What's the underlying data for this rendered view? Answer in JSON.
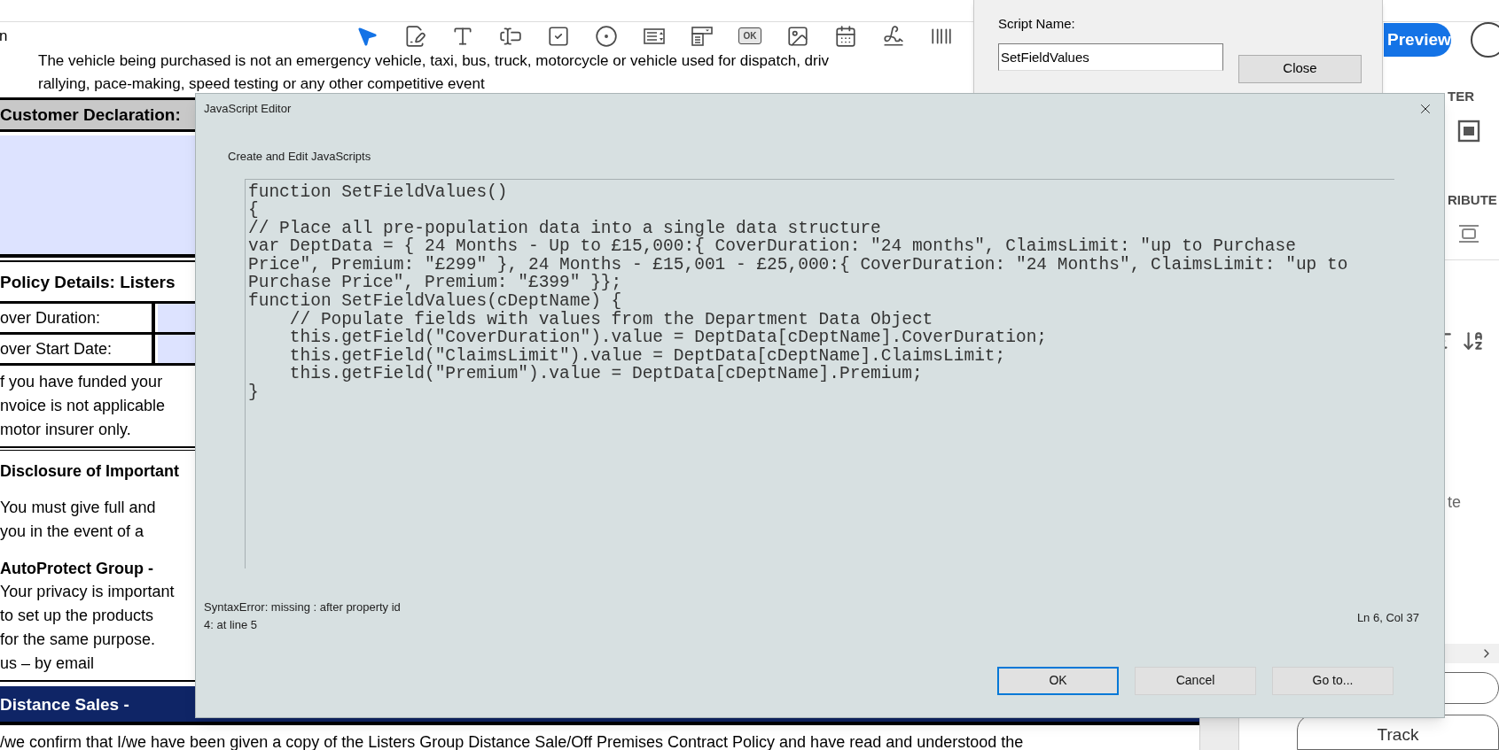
{
  "toolbar": {
    "cropped_label": "n",
    "tools": [
      {
        "kind": "select",
        "selected": true
      },
      {
        "kind": "edit-form",
        "selected": false
      },
      {
        "kind": "text",
        "selected": false
      },
      {
        "kind": "text-field",
        "selected": false
      },
      {
        "kind": "checkbox",
        "selected": false
      },
      {
        "kind": "radio",
        "selected": false
      },
      {
        "kind": "list-box",
        "selected": false
      },
      {
        "kind": "dropdown",
        "selected": false
      },
      {
        "kind": "button",
        "selected": false,
        "label": "OK"
      },
      {
        "kind": "image",
        "selected": false
      },
      {
        "kind": "date",
        "selected": false
      },
      {
        "kind": "signature",
        "selected": false
      },
      {
        "kind": "barcode",
        "selected": false
      }
    ]
  },
  "document": {
    "intro_lines": [
      "The vehicle being purchased is not an emergency vehicle, taxi, bus, truck, motorcycle or vehicle used for dispatch, driv",
      "rallying, pace-making, speed testing or any other competitive event"
    ],
    "declaration_heading": "Customer Declaration:",
    "policy_heading": "Policy Details: Listers",
    "policy_rows": [
      {
        "label": "over Duration:"
      },
      {
        "label": "over Start Date:"
      }
    ],
    "funding_lines": [
      "f you have funded your",
      "nvoice is not applicable",
      "motor insurer only."
    ],
    "disclosure_heading": "Disclosure of Important",
    "disclosure_lines": [
      "You must give full and",
      "you in the event of a"
    ],
    "privacy_heading": "AutoProtect Group -",
    "privacy_lines": [
      "Your privacy is important",
      "to set up the products",
      "for the same purpose.",
      "us – by email"
    ],
    "distance_heading": "Distance Sales -",
    "confirm_line": "/we confirm that I/we have been given a copy of the Listers Group Distance Sale/Off Premises Contract Policy and have read and understood the"
  },
  "right_panel": {
    "preview_button": "Preview",
    "align_heading": "TER",
    "distribute_heading": "RIBUTE",
    "partial_label": "te",
    "track_button": "Track"
  },
  "script_dialog": {
    "label": "Script Name:",
    "value": "SetFieldValues",
    "close_button": "Close"
  },
  "editor": {
    "title": "JavaScript Editor",
    "subtitle": "Create and Edit JavaScripts",
    "code_lines": [
      "function SetFieldValues()",
      "{",
      "// Place all pre-population data into a single data structure",
      "var DeptData = { 24 Months - Up to £15,000:{ CoverDuration: \"24 months\", ClaimsLimit: \"up to Purchase",
      "Price\", Premium: \"£299\" }, 24 Months - £15,001 - £25,000:{ CoverDuration: \"24 Months\", ClaimsLimit: \"up to",
      "Purchase Price\", Premium: \"£399\" }};",
      "function SetFieldValues(cDeptName) {",
      "    // Populate fields with values from the Department Data Object",
      "    this.getField(\"CoverDuration\").value = DeptData[cDeptName].CoverDuration;",
      "    this.getField(\"ClaimsLimit\").value = DeptData[cDeptName].ClaimsLimit;",
      "    this.getField(\"Premium\").value = DeptData[cDeptName].Premium;",
      "}"
    ],
    "error_lines": [
      "SyntaxError: missing : after property id",
      "4: at line 5"
    ],
    "cursor_position": "Ln 6, Col 37",
    "buttons": [
      {
        "label": "OK",
        "default": true
      },
      {
        "label": "Cancel",
        "default": false
      },
      {
        "label": "Go to...",
        "default": false
      }
    ]
  }
}
